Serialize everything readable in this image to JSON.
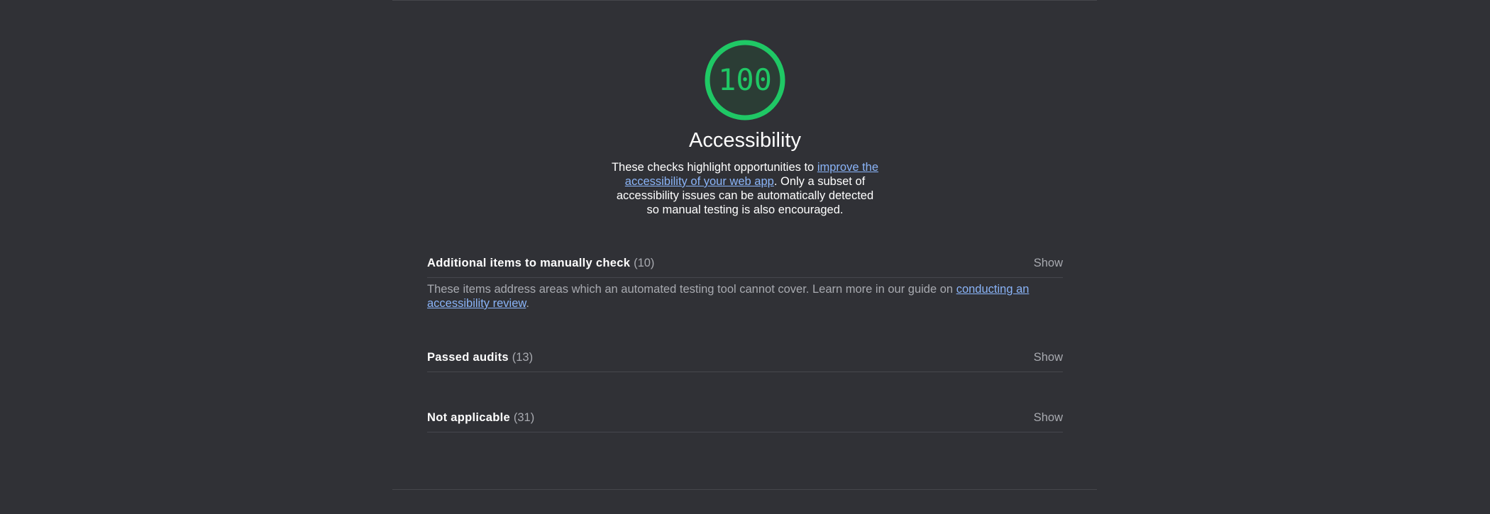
{
  "score": {
    "value": "100",
    "ring_color": "#1fc865",
    "fill_color": "#2b3d35"
  },
  "category": {
    "title": "Accessibility",
    "description_before": "These checks highlight opportunities to ",
    "description_link": "improve the accessibility of your web app",
    "description_after": ". Only a subset of accessibility issues can be automatically detected so manual testing is also encouraged."
  },
  "groups": [
    {
      "title": "Additional items to manually check",
      "count": "(10)",
      "toggle": "Show",
      "desc_before": "These items address areas which an automated testing tool cannot cover. Learn more in our guide on ",
      "desc_link": "conducting an accessibility review",
      "desc_after": "."
    },
    {
      "title": "Passed audits",
      "count": "(13)",
      "toggle": "Show"
    },
    {
      "title": "Not applicable",
      "count": "(31)",
      "toggle": "Show"
    }
  ],
  "colors": {
    "background": "#303136",
    "link": "#8ab4f8",
    "pass": "#1fc865",
    "muted_text": "#a8aab0"
  }
}
